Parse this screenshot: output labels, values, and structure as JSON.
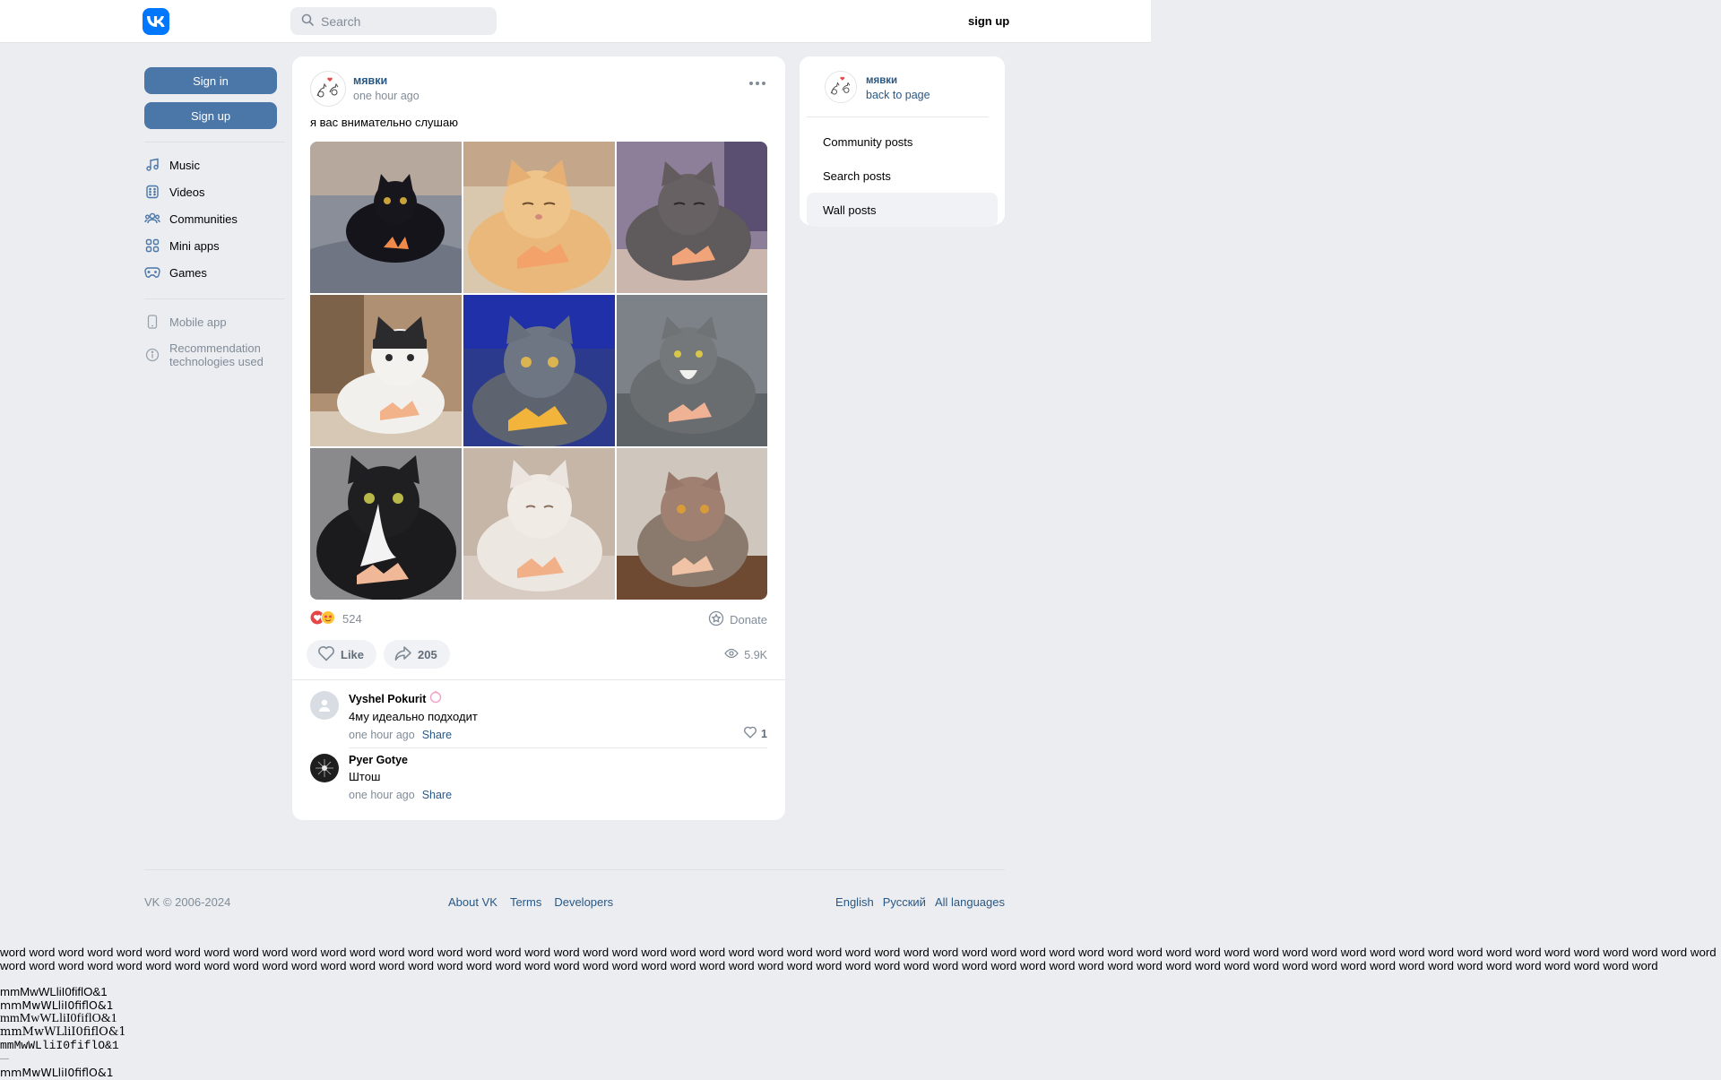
{
  "header": {
    "search_placeholder": "Search",
    "signup_label": "sign up"
  },
  "leftnav": {
    "signin_label": "Sign in",
    "signup_label": "Sign up",
    "items": [
      {
        "label": "Music",
        "icon": "music-icon"
      },
      {
        "label": "Videos",
        "icon": "video-icon"
      },
      {
        "label": "Communities",
        "icon": "communities-icon"
      },
      {
        "label": "Mini apps",
        "icon": "mini-apps-icon"
      },
      {
        "label": "Games",
        "icon": "gamepad-icon"
      }
    ],
    "secondary": [
      {
        "label": "Mobile app",
        "icon": "phone-icon"
      },
      {
        "label": "Recommendation technologies used",
        "icon": "info-icon"
      }
    ]
  },
  "post": {
    "author": "мявки",
    "time": "one hour ago",
    "text": "я вас внимательно слушаю",
    "reactions_count": "524",
    "donate_label": "Donate",
    "like_label": "Like",
    "shares_count": "205",
    "views_count": "5.9K",
    "photos": [
      {
        "desc": "black cat with tiny hands on grey blanket"
      },
      {
        "desc": "ginger cat with tiny hands"
      },
      {
        "desc": "grey cat with tiny hands"
      },
      {
        "desc": "white and black cat with tiny hands"
      },
      {
        "desc": "grey cat in blue light with tiny hands"
      },
      {
        "desc": "tabby cat with tiny hands"
      },
      {
        "desc": "black and white cat with tiny hands"
      },
      {
        "desc": "white cat with tiny hands"
      },
      {
        "desc": "fluffy brown cat with tiny hands"
      }
    ]
  },
  "comments": [
    {
      "name": "Vyshel Pokurit",
      "text": "4му идеально подходит",
      "time": "one hour ago",
      "share": "Share",
      "likes": "1"
    },
    {
      "name": "Pyer Gotye",
      "text": "Штош",
      "time": "one hour ago",
      "share": "Share"
    }
  ],
  "rightpanel": {
    "name": "мявки",
    "back_label": "back to page",
    "items": [
      "Community posts",
      "Search posts",
      "Wall posts"
    ],
    "active_index": 2
  },
  "footer": {
    "copyright": "VK © 2006-2024",
    "links": [
      "About VK",
      "Terms",
      "Developers"
    ],
    "languages": [
      "English",
      "Русский",
      "All languages"
    ]
  },
  "font_test": {
    "word_line": "word word word word word word word word word word word word word word word word word word word word word word word word word word word word word word word word word word word word word word word word word word word word word word word word word word word word word word word word word word word word word word word word word word word word word word word word word word word word word word word word word word word word word word word word word word word word word word word word word word word word word word word word word word word word word word word word word word word word",
    "sample": "mmMwWLliI0fiflO&1"
  },
  "colors": {
    "brand": "#0077ff",
    "button": "#4a76a8",
    "link": "#2a5885",
    "background": "#ebedf0"
  }
}
